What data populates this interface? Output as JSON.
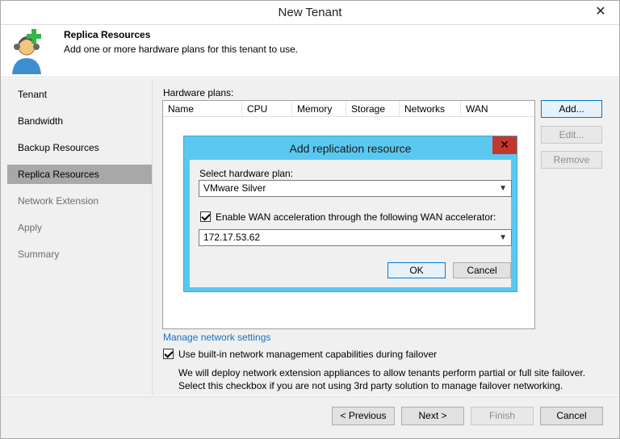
{
  "window": {
    "title": "New Tenant",
    "close_glyph": "✕"
  },
  "header": {
    "title": "Replica Resources",
    "subtitle": "Add one or more hardware plans for this tenant to use.",
    "icon": "tenant-add-icon"
  },
  "nav": {
    "items": [
      {
        "label": "Tenant",
        "state": "normal"
      },
      {
        "label": "Bandwidth",
        "state": "normal"
      },
      {
        "label": "Backup Resources",
        "state": "normal"
      },
      {
        "label": "Replica Resources",
        "state": "active"
      },
      {
        "label": "Network Extension",
        "state": "dim"
      },
      {
        "label": "Apply",
        "state": "dim"
      },
      {
        "label": "Summary",
        "state": "dim"
      }
    ]
  },
  "content": {
    "hardware_plans_label": "Hardware plans:",
    "columns": [
      "Name",
      "CPU",
      "Memory",
      "Storage",
      "Networks",
      "WAN"
    ],
    "buttons": {
      "add": "Add...",
      "edit": "Edit...",
      "remove": "Remove"
    },
    "manage_link": "Manage network settings",
    "builtin_checkbox": {
      "checked": true,
      "label": "Use built-in network management capabilities during failover"
    },
    "description_line1": "We will deploy network extension appliances to allow tenants perform partial or full site failover.",
    "description_line2": "Select this checkbox if you are not using 3rd party solution to manage failover networking."
  },
  "footer": {
    "previous": "< Previous",
    "next": "Next >",
    "finish": "Finish",
    "cancel": "Cancel"
  },
  "modal": {
    "title": "Add replication resource",
    "close_glyph": "✕",
    "select_plan_label": "Select hardware plan:",
    "selected_plan": "VMware Silver",
    "wan_checkbox": {
      "checked": true,
      "label": "Enable WAN acceleration through the following WAN accelerator:"
    },
    "selected_accelerator": "172.17.53.62",
    "ok": "OK",
    "cancel": "Cancel",
    "colors": {
      "frame": "#5ac8f0",
      "close": "#c7362c"
    }
  }
}
